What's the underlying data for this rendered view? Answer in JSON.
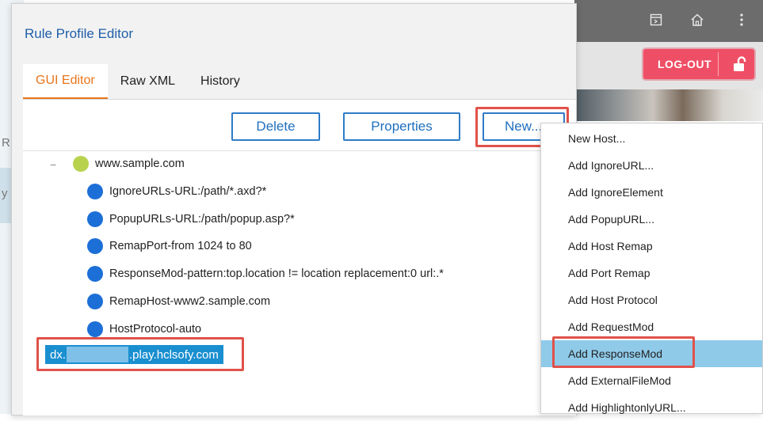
{
  "background": {
    "topbar_icons": [
      "sidebar-toggle-icon",
      "home-icon",
      "more-vertical-icon"
    ],
    "logout_label": "LOG-OUT",
    "left_chars": [
      "R",
      "y"
    ]
  },
  "dialog": {
    "title": "Rule Profile Editor",
    "tabs": [
      {
        "label": "GUI Editor",
        "active": true
      },
      {
        "label": "Raw XML",
        "active": false
      },
      {
        "label": "History",
        "active": false
      }
    ],
    "toolbar": {
      "delete_label": "Delete",
      "properties_label": "Properties",
      "new_label": "New..."
    },
    "tree": {
      "collapse_symbol": "−",
      "root": "www.sample.com",
      "children": [
        "IgnoreURLs-URL:/path/*.axd?*",
        "PopupURLs-URL:/path/popup.asp?*",
        "RemapPort-from 1024 to 80",
        "ResponseMod-pattern:top.location != location replacement:0 url:.*",
        "RemapHost-www2.sample.com",
        "HostProtocol-auto"
      ],
      "selected_prefix": "dx.",
      "selected_suffix": ".play.hclsofy.com"
    }
  },
  "menu": {
    "items": [
      "New Host...",
      "Add IgnoreURL...",
      "Add IgnoreElement",
      "Add PopupURL...",
      "Add Host Remap",
      "Add Port Remap",
      "Add Host Protocol",
      "Add RequestMod",
      "Add ResponseMod",
      "Add ExternalFileMod",
      "Add HighlightonlyURL..."
    ],
    "highlighted_index": 8
  },
  "colors": {
    "accent": "#e8751a",
    "primary": "#1f6fbf",
    "annotation": "#e0524a",
    "selection": "#1a8fd0",
    "menu_hover": "#8fcae9"
  }
}
